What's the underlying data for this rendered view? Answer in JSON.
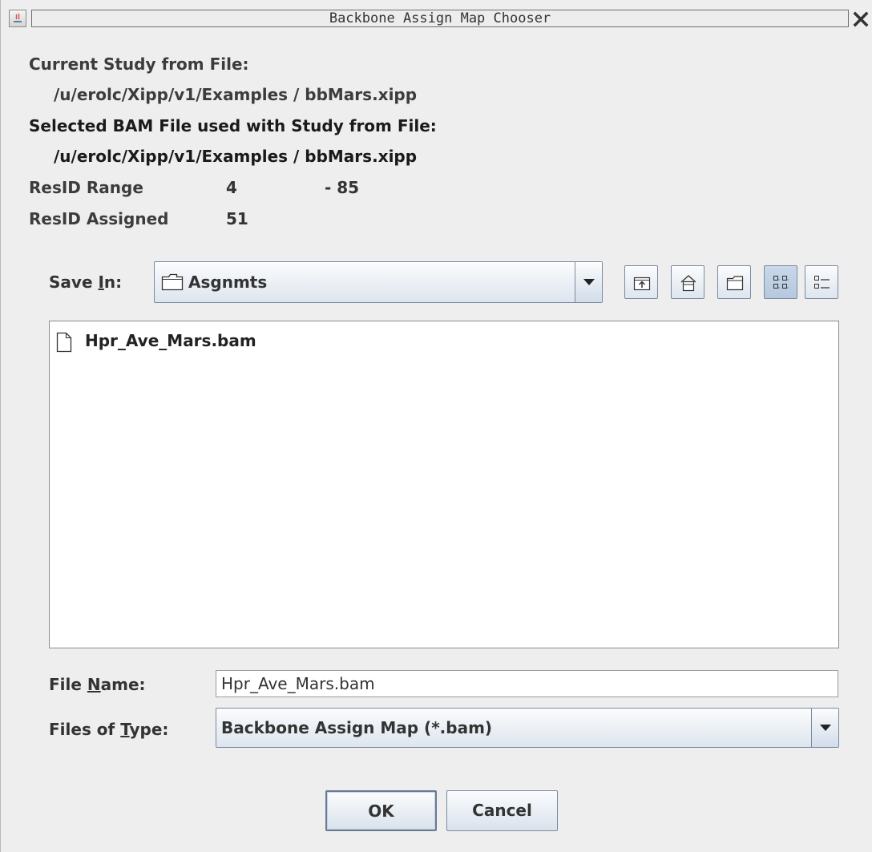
{
  "window": {
    "title": "Backbone Assign Map Chooser"
  },
  "info": {
    "current_study_label": "Current Study from File:",
    "current_study_path": "/u/erolc/Xipp/v1/Examples / bbMars.xipp",
    "selected_bam_label": "Selected BAM File used with Study from File:",
    "selected_bam_path": "/u/erolc/Xipp/v1/Examples / bbMars.xipp",
    "resid_range_label": "ResID Range",
    "resid_range_start": "4",
    "resid_range_end": "- 85",
    "resid_assigned_label": "ResID Assigned",
    "resid_assigned_value": "51"
  },
  "save_in": {
    "label_prefix": "Save ",
    "label_mnemonic": "I",
    "label_suffix": "n:",
    "selected": "Asgnmts",
    "toolbar": [
      "up-folder-icon",
      "home-icon",
      "new-folder-icon",
      "list-view-icon",
      "details-view-icon"
    ],
    "selected_view": "list-view"
  },
  "file_list": {
    "items": [
      {
        "name": "Hpr_Ave_Mars.bam",
        "icon": "file-icon"
      }
    ]
  },
  "file_name": {
    "label_prefix": "File ",
    "label_mnemonic": "N",
    "label_suffix": "ame:",
    "value": "Hpr_Ave_Mars.bam"
  },
  "files_of_type": {
    "label_prefix": "Files of ",
    "label_mnemonic": "T",
    "label_suffix": "ype:",
    "selected": "Backbone Assign Map (*.bam)"
  },
  "buttons": {
    "ok": "OK",
    "cancel": "Cancel"
  },
  "colors": {
    "background": "#eeeeee",
    "control_border": "#7a8aa0",
    "selected_toggle": "#b5c8de"
  }
}
